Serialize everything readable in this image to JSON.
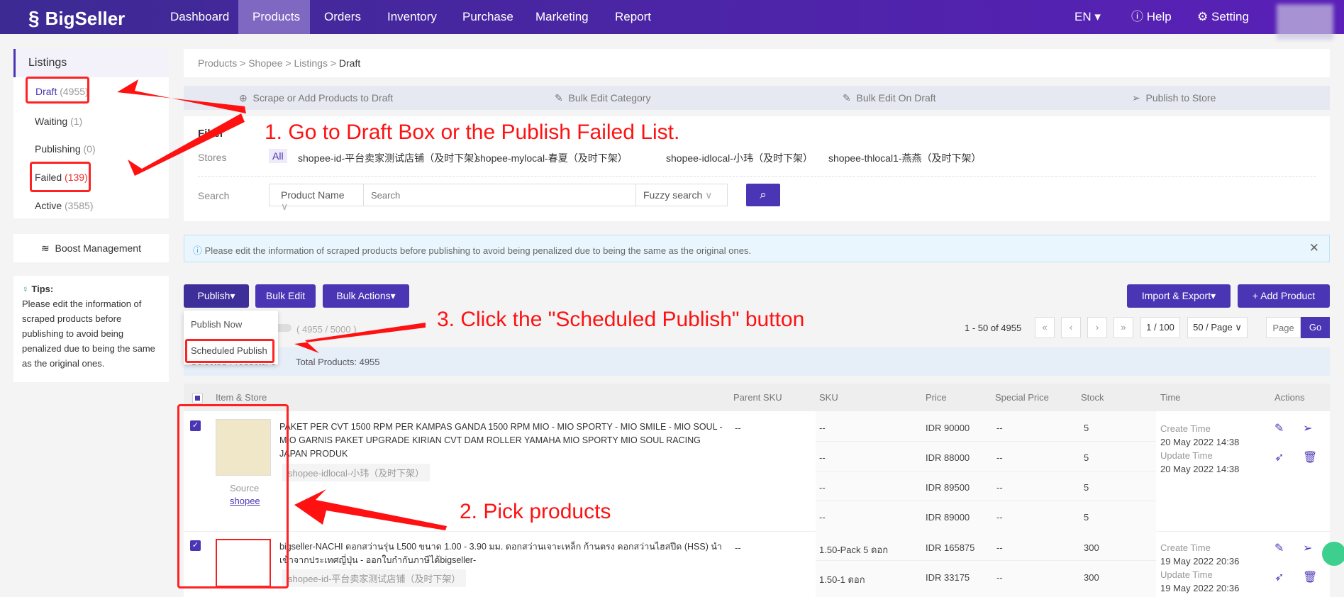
{
  "nav": {
    "brand": "BigSeller",
    "items": [
      "Dashboard",
      "Products",
      "Orders",
      "Inventory",
      "Purchase",
      "Marketing",
      "Report"
    ],
    "active": "Products",
    "lang": "EN",
    "help": "Help",
    "setting": "Setting"
  },
  "sidebar": {
    "title": "Listings",
    "items": [
      {
        "label": "Draft",
        "count": "(4955)"
      },
      {
        "label": "Waiting",
        "count": "(1)"
      },
      {
        "label": "Publishing",
        "count": "(0)"
      },
      {
        "label": "Failed",
        "count": "(139)"
      },
      {
        "label": "Active",
        "count": "(3585)"
      }
    ],
    "boost": "Boost Management",
    "tips_title": "Tips:",
    "tips_text": "Please edit the information of scraped products before publishing to avoid being penalized due to being the same as the original ones."
  },
  "breadcrumb": [
    "Products",
    "Shopee",
    "Listings",
    "Draft"
  ],
  "steps": [
    "Scrape or Add Products to Draft",
    "Bulk Edit Category",
    "Bulk Edit On Draft",
    "Publish to Store"
  ],
  "filter": {
    "title": "Filter",
    "stores_label": "Stores",
    "stores": [
      "All",
      "shopee-id-平台卖家测试店铺（及时下架）",
      "shopee-mylocal-春夏（及时下架）",
      "shopee-idlocal-小玮（及时下架）",
      "shopee-thlocal1-燕燕（及时下架）"
    ],
    "search_label": "Search",
    "field": "Product Name",
    "search_placeholder": "Search",
    "mode": "Fuzzy search"
  },
  "banner": "Please edit the information of scraped products before publishing to avoid being penalized due to being the same as the original ones.",
  "toolbar": {
    "publish": "Publish",
    "bulk_edit": "Bulk Edit",
    "bulk_actions": "Bulk Actions",
    "import_export": "Import & Export",
    "add_product": "+ Add Product",
    "menu": [
      "Publish Now",
      "Scheduled Publish"
    ],
    "quota": "( 4955 / 5000 )"
  },
  "pagination": {
    "range": "1 - 50 of 4955",
    "page": "1 / 100",
    "per_page": "50 / Page",
    "page_placeholder": "Page",
    "go": "Go"
  },
  "selected": {
    "label": "Selected Products: 0",
    "total": "Total Products: 4955"
  },
  "table": {
    "headers": [
      "Item & Store",
      "Parent SKU",
      "SKU",
      "Price",
      "Special Price",
      "Stock",
      "Time",
      "Actions"
    ],
    "rows": [
      {
        "title": "PAKET PER CVT 1500 RPM PER KAMPAS GANDA 1500 RPM MIO - MIO SPORTY - MIO SMILE - MIO SOUL - MIO GARNIS PAKET UPGRADE KIRIAN CVT DAM ROLLER YAMAHA MIO SPORTY MIO SOUL RACING JAPAN PRODUK",
        "store": "shopee-idlocal-小玮（及时下架）",
        "source_label": "Source",
        "source": "shopee",
        "parent_sku": "--",
        "variants": [
          {
            "sku": "--",
            "price": "IDR 90000",
            "special": "--",
            "stock": "5"
          },
          {
            "sku": "--",
            "price": "IDR 88000",
            "special": "--",
            "stock": "5"
          },
          {
            "sku": "--",
            "price": "IDR 89500",
            "special": "--",
            "stock": "5"
          },
          {
            "sku": "--",
            "price": "IDR 89000",
            "special": "--",
            "stock": "5"
          }
        ],
        "create_label": "Create Time",
        "create": "20 May 2022 14:38",
        "update_label": "Update Time",
        "update": "20 May 2022 14:38"
      },
      {
        "title": "bigseller-NACHI ดอกสว่านรุ่น L500 ขนาด 1.00 - 3.90 มม. ดอกสว่านเจาะเหล็ก ก้านตรง ดอกสว่านไฮสปีด (HSS) นำเข้าจากประเทศญี่ปุ่น - ออกใบกำกับภาษีได้bigseller-",
        "store": "shopee-id-平台卖家测试店铺（及时下架）",
        "parent_sku": "--",
        "variants": [
          {
            "sku": "1.50-Pack 5 ดอก",
            "price": "IDR 165875",
            "special": "--",
            "stock": "300"
          },
          {
            "sku": "1.50-1 ดอก",
            "price": "IDR 33175",
            "special": "--",
            "stock": "300"
          }
        ],
        "create_label": "Create Time",
        "create": "19 May 2022 20:36",
        "update_label": "Update Time",
        "update": "19 May 2022 20:36"
      }
    ]
  },
  "annotations": [
    "1. Go to Draft Box or the Publish Failed List.",
    "2. Pick products",
    "3. Click the \"Scheduled Publish\" button"
  ],
  "colors": {
    "primary": "#4a36b5",
    "annotation": "#ff1111"
  }
}
